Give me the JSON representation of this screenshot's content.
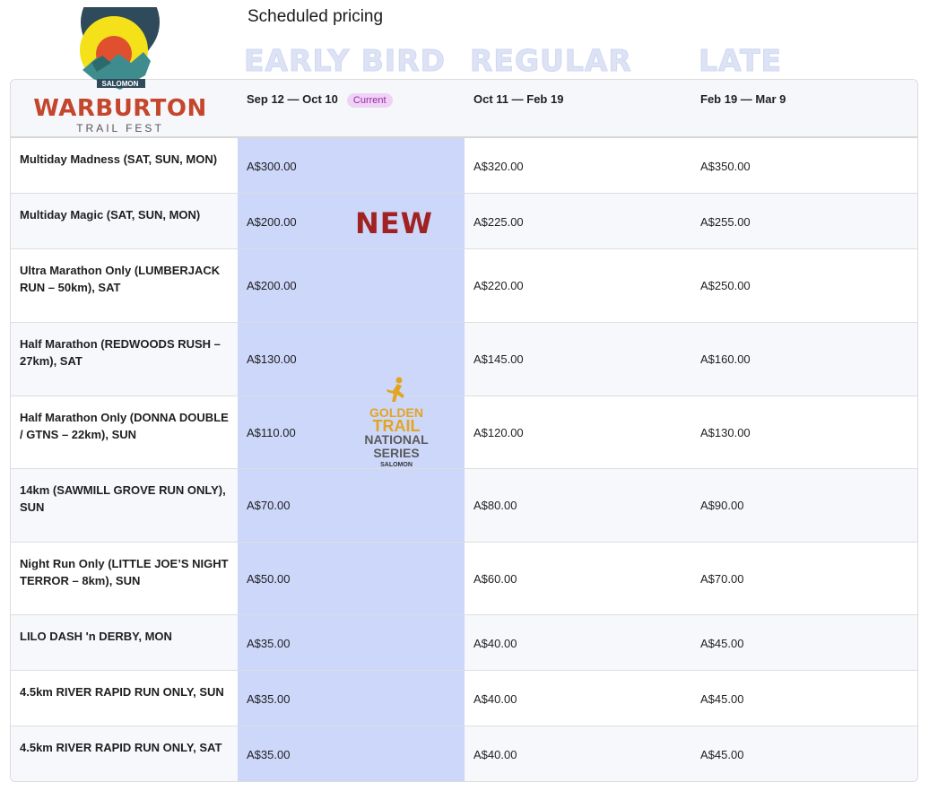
{
  "page": {
    "title": "Scheduled pricing"
  },
  "tiers": {
    "early": "EARLY BIRD",
    "regular": "REGULAR",
    "late": "LATE"
  },
  "logo": {
    "brand": "SALOMON",
    "name": "WARBURTON",
    "sub": "TRAIL FEST"
  },
  "overlay": {
    "new_tag": "NEW",
    "gtns": {
      "line1": "GOLDEN",
      "line2": "TRAIL",
      "line3": "NATIONAL",
      "line4": "SERIES",
      "line5": "SALOMON"
    }
  },
  "columns": {
    "early": "Sep 12 — Oct 10",
    "current_badge": "Current",
    "regular": "Oct 11 — Feb 19",
    "late": "Feb 19 — Mar 9"
  },
  "rows": [
    {
      "name": "Multiday Madness (SAT, SUN, MON)",
      "early": "A$300.00",
      "regular": "A$320.00",
      "late": "A$350.00"
    },
    {
      "name": "Multiday Magic (SAT, SUN, MON)",
      "early": "A$200.00",
      "regular": "A$225.00",
      "late": "A$255.00"
    },
    {
      "name": "Ultra Marathon Only (LUMBERJACK RUN – 50km), SAT",
      "early": "A$200.00",
      "regular": "A$220.00",
      "late": "A$250.00"
    },
    {
      "name": "Half Marathon (REDWOODS RUSH – 27km), SAT",
      "early": "A$130.00",
      "regular": "A$145.00",
      "late": "A$160.00"
    },
    {
      "name": "Half Marathon Only (DONNA DOUBLE / GTNS – 22km), SUN",
      "early": "A$110.00",
      "regular": "A$120.00",
      "late": "A$130.00"
    },
    {
      "name": "14km (SAWMILL GROVE RUN ONLY), SUN",
      "early": "A$70.00",
      "regular": "A$80.00",
      "late": "A$90.00"
    },
    {
      "name": "Night Run Only (LITTLE JOE’S NIGHT TERROR – 8km), SUN",
      "early": "A$50.00",
      "regular": "A$60.00",
      "late": "A$70.00"
    },
    {
      "name": "LILO DASH 'n DERBY, MON",
      "early": "A$35.00",
      "regular": "A$40.00",
      "late": "A$45.00"
    },
    {
      "name": "4.5km RIVER RAPID RUN ONLY, SUN",
      "early": "A$35.00",
      "regular": "A$40.00",
      "late": "A$45.00"
    },
    {
      "name": "4.5km RIVER RAPID RUN ONLY, SAT",
      "early": "A$35.00",
      "regular": "A$40.00",
      "late": "A$45.00"
    }
  ],
  "colors": {
    "early_col": "#ccd7fa",
    "badge_bg": "#efd3f5",
    "badge_fg": "#9b2aa8",
    "logo_red": "#c4462c",
    "gold": "#e3a521"
  }
}
